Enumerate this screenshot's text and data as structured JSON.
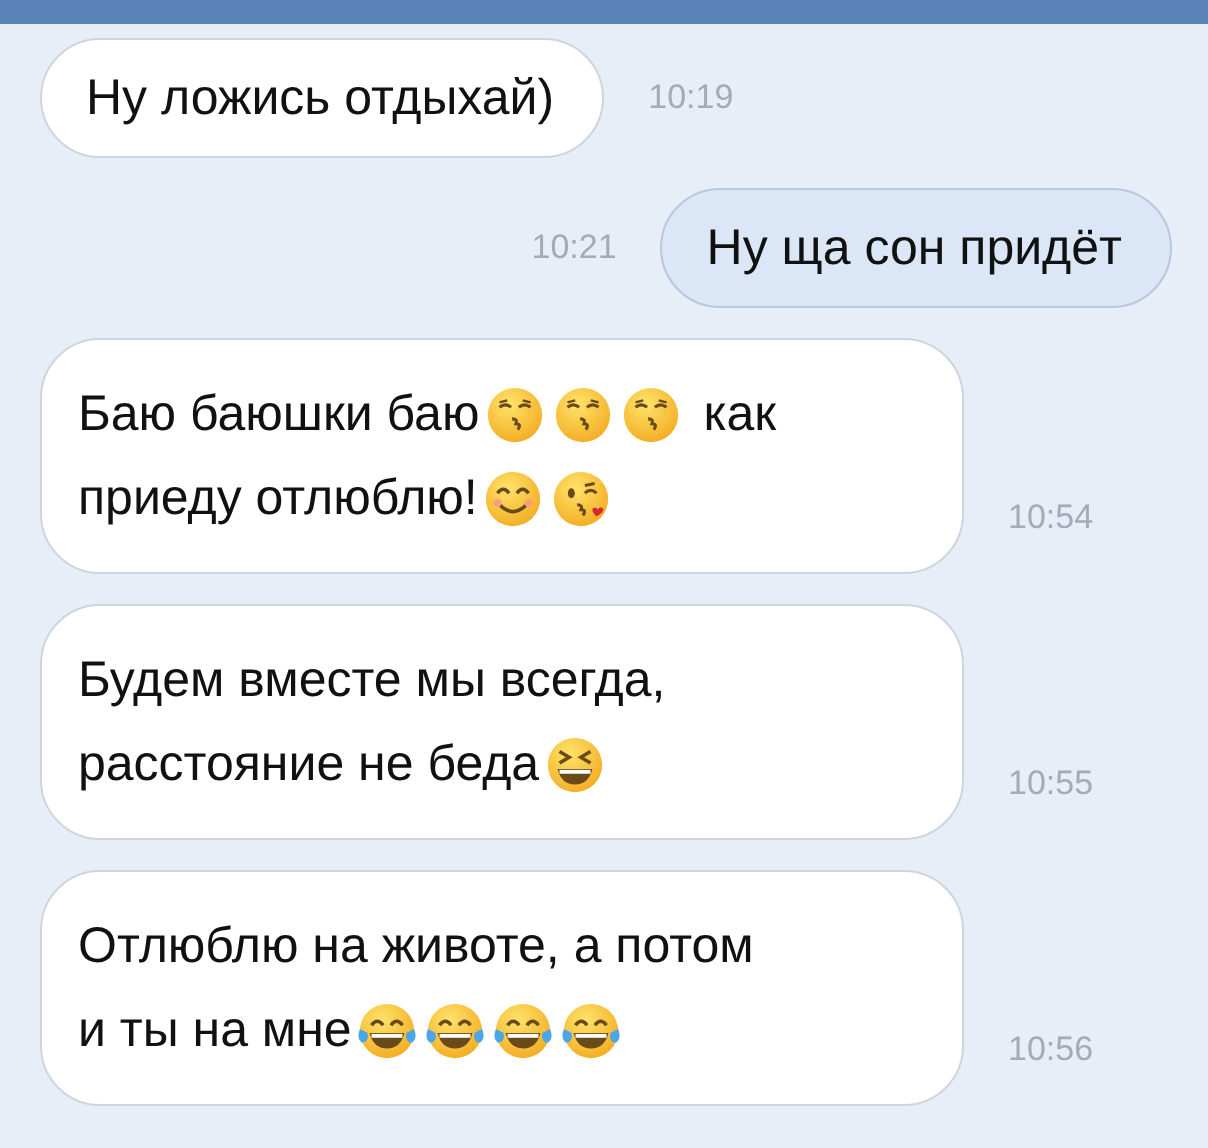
{
  "messages": [
    {
      "kind": "incoming",
      "time": "10:19",
      "lines": [
        [
          {
            "kind": "text",
            "text": "Ну ложись отдыхай)"
          }
        ]
      ]
    },
    {
      "kind": "outgoing",
      "time": "10:21",
      "lines": [
        [
          {
            "kind": "text",
            "text": "Ну ща сон придёт"
          }
        ]
      ]
    },
    {
      "kind": "incoming",
      "time": "10:54",
      "lines": [
        [
          {
            "kind": "text",
            "text": "Баю баюшки баю"
          },
          {
            "kind": "kiss"
          },
          {
            "kind": "kiss"
          },
          {
            "kind": "kiss"
          },
          {
            "kind": "text",
            "text": "как"
          }
        ],
        [
          {
            "kind": "text",
            "text": "приеду отлюблю!"
          },
          {
            "kind": "smile"
          },
          {
            "kind": "wink-kiss"
          }
        ]
      ]
    },
    {
      "kind": "incoming",
      "time": "10:55",
      "lines": [
        [
          {
            "kind": "text",
            "text": "Будем вместе мы всегда,"
          }
        ],
        [
          {
            "kind": "text",
            "text": "расстояние не беда"
          },
          {
            "kind": "laugh"
          }
        ]
      ]
    },
    {
      "kind": "incoming",
      "time": "10:56",
      "lines": [
        [
          {
            "kind": "text",
            "text": "Отлюблю на животе, а потом"
          }
        ],
        [
          {
            "kind": "text",
            "text": "и ты на мне"
          },
          {
            "kind": "tears"
          },
          {
            "kind": "tears"
          },
          {
            "kind": "tears"
          },
          {
            "kind": "tears"
          }
        ]
      ]
    }
  ]
}
